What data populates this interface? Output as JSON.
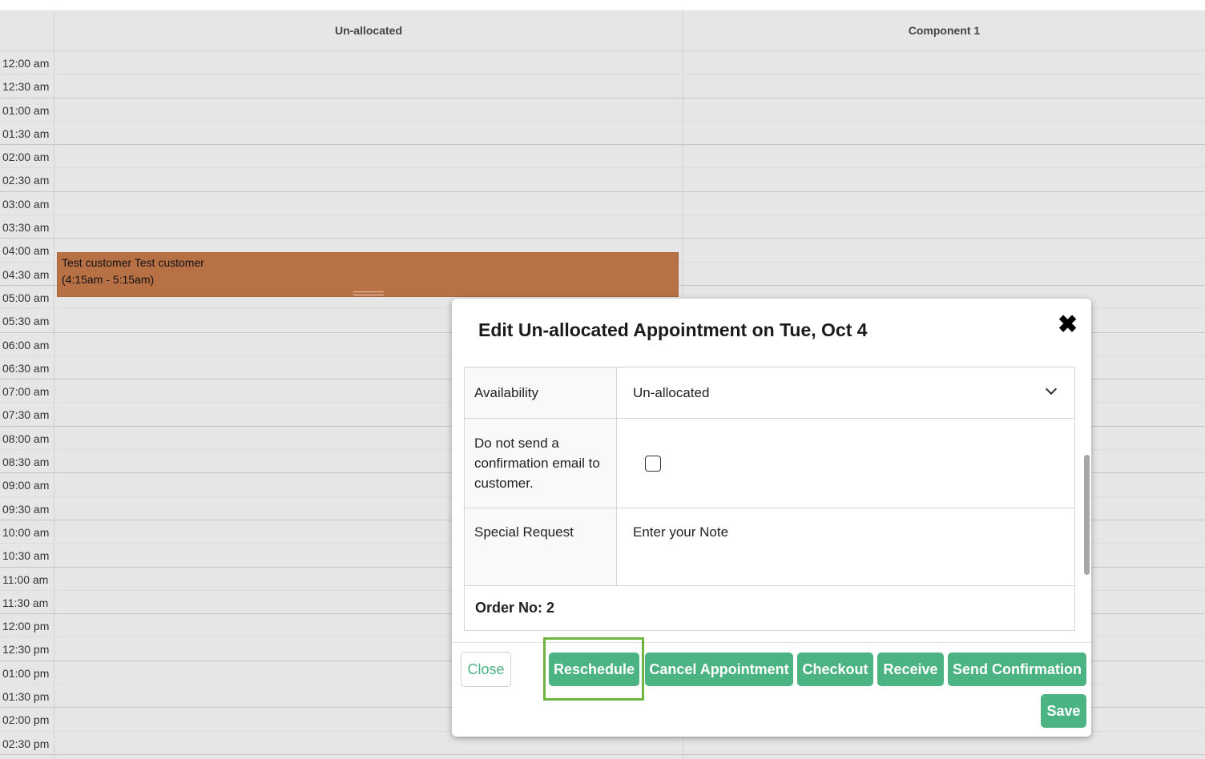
{
  "calendar": {
    "columns": [
      "Un-allocated",
      "Component 1"
    ],
    "times": [
      "12:00 am",
      "12:30 am",
      "01:00 am",
      "01:30 am",
      "02:00 am",
      "02:30 am",
      "03:00 am",
      "03:30 am",
      "04:00 am",
      "04:30 am",
      "05:00 am",
      "05:30 am",
      "06:00 am",
      "06:30 am",
      "07:00 am",
      "07:30 am",
      "08:00 am",
      "08:30 am",
      "09:00 am",
      "09:30 am",
      "10:00 am",
      "10:30 am",
      "11:00 am",
      "11:30 am",
      "12:00 pm",
      "12:30 pm",
      "01:00 pm",
      "01:30 pm",
      "02:00 pm",
      "02:30 pm"
    ],
    "event": {
      "name": "Test customer Test customer",
      "time": "(4:15am - 5:15am)",
      "color": "#b87145"
    }
  },
  "modal": {
    "title": "Edit Un-allocated Appointment on Tue, Oct 4",
    "close_icon": "close-x-icon",
    "fields": {
      "availability_label": "Availability",
      "availability_value": "Un-allocated",
      "confirmation_label": "Do not send a confirmation email to customer.",
      "special_request_label": "Special Request",
      "special_request_placeholder": "Enter your Note",
      "order_no": "Order No: 2"
    },
    "buttons": {
      "close": "Close",
      "reschedule": "Reschedule",
      "cancel": "Cancel Appointment",
      "checkout": "Checkout",
      "receive": "Receive",
      "send_confirmation": "Send Confirmation",
      "save": "Save"
    },
    "accent": "#4cb383"
  }
}
